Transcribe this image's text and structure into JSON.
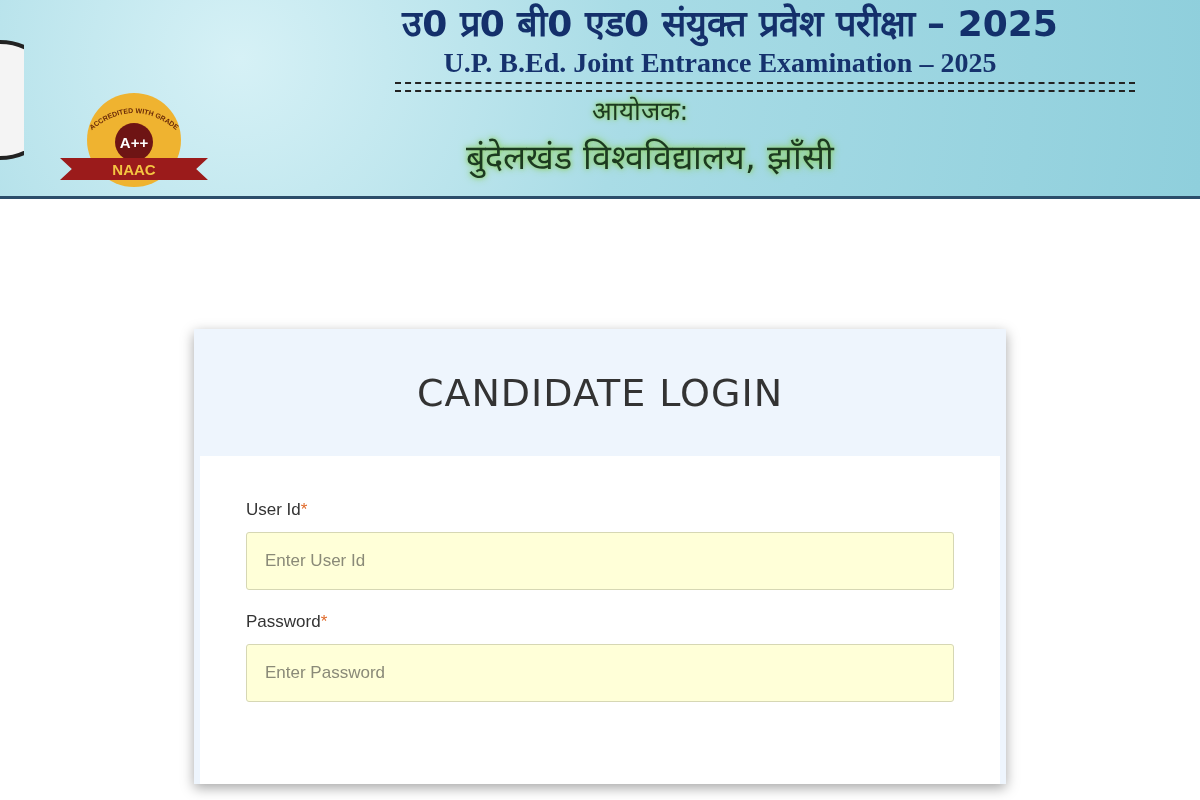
{
  "banner": {
    "title_hindi": "उ0 प्र0 बी0 एड0 संयुक्त प्रवेश परीक्षा – 2025",
    "title_english": "U.P. B.Ed. Joint Entrance Examination – 2025",
    "organizer_label": "आयोजक:",
    "organizer": "बुंदेलखंड विश्वविद्यालय, झाँसी",
    "badge": {
      "ring_text": "ACCREDITED WITH GRADE",
      "grade": "A++",
      "ribbon": "NAAC"
    }
  },
  "login": {
    "title": "CANDIDATE LOGIN",
    "fields": [
      {
        "label": "User Id",
        "required_mark": "*",
        "placeholder": "Enter User Id"
      },
      {
        "label": "Password",
        "required_mark": "*",
        "placeholder": "Enter Password"
      }
    ]
  }
}
